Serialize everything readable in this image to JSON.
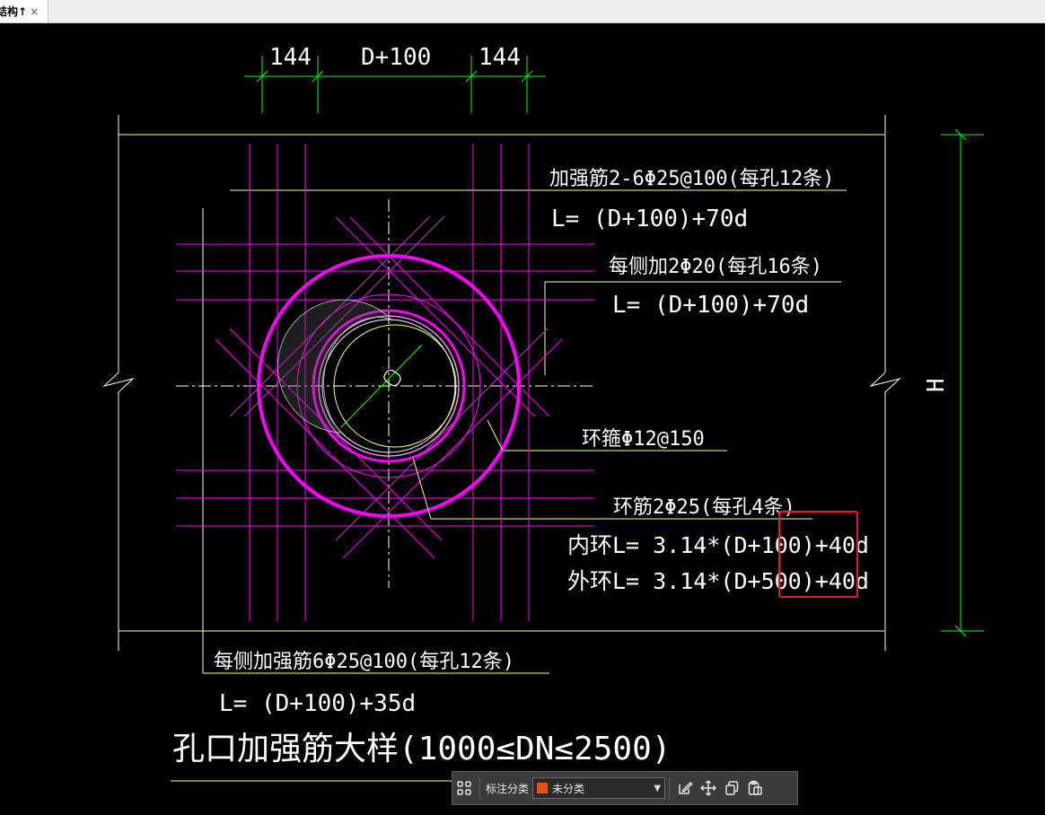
{
  "tab": {
    "title": "结构↑",
    "close_glyph": "×"
  },
  "drawing": {
    "dims": {
      "left": "144",
      "middle": "D+100",
      "right": "144",
      "height": "H"
    },
    "labels": {
      "top_rebar": "加强筋2-6Φ25@100(每孔12条)",
      "top_rebar_len": "L=  (D+100)+70d",
      "side_add": "每侧加2Φ20(每孔16条)",
      "side_add_len": "L=  (D+100)+70d",
      "hoop": "环箍Φ12@150",
      "ring": "环筋2Φ25(每孔4条)",
      "inner_ring": "内环L=  3.14*(D+100)+40d",
      "outer_ring": "外环L=  3.14*(D+500)+40d",
      "bottom_rebar": "每侧加强筋6Φ25@100(每孔12条)",
      "bottom_rebar_len": "L=  (D+100)+35d",
      "title": "孔口加强筋大样(1000≤DN≤2500)"
    },
    "colors": {
      "yellow": "#ffff80",
      "green": "#00ff00",
      "magenta": "#ff00ff",
      "white": "#ffffff",
      "highlight": "#e02020"
    }
  },
  "toolbar": {
    "label": "标注分类",
    "select_value": "未分类",
    "swatch_color": "#e8520c",
    "icons": [
      "grid-icon",
      "edit-icon",
      "move-icon",
      "copy-icon",
      "paste-icon"
    ]
  }
}
